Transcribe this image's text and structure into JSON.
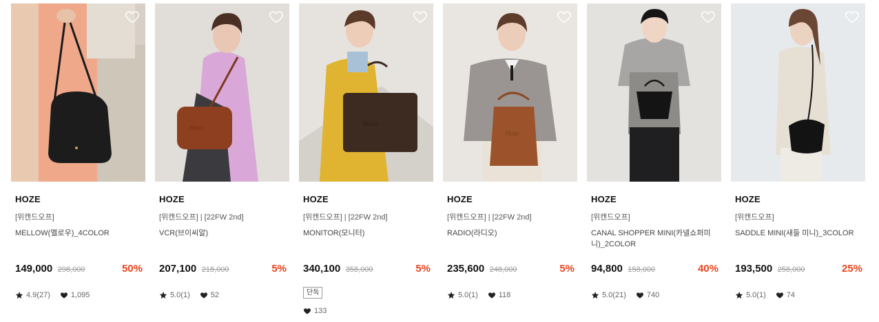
{
  "colors": {
    "discount": "#e8441e",
    "price": "#111111",
    "strike": "#999999"
  },
  "products": [
    {
      "brand": "HOZE",
      "tag": "[위캔드오프]",
      "name": "MELLOW(멜로우)_4COLOR",
      "price": "149,000",
      "original_price": "298,000",
      "discount": "50%",
      "rating": "4.9(27)",
      "likes": "1,095",
      "image": "woman holding black hobo bag"
    },
    {
      "brand": "HOZE",
      "tag": "[위캔드오프] | [22FW 2nd]",
      "name": "VCR(브이씨알)",
      "price": "207,100",
      "original_price": "218,000",
      "discount": "5%",
      "rating": "5.0(1)",
      "likes": "52",
      "image": "woman in pink sweater with brown crossbody bag"
    },
    {
      "brand": "HOZE",
      "tag": "[위캔드오프] | [22FW 2nd]",
      "name": "MONITOR(모니터)",
      "price": "340,100",
      "original_price": "358,000",
      "discount": "5%",
      "badge": "단독",
      "likes": "133",
      "image": "woman in yellow jacket with dark brown briefcase bag"
    },
    {
      "brand": "HOZE",
      "tag": "[위캔드오프] | [22FW 2nd]",
      "name": "RADIO(라디오)",
      "price": "235,600",
      "original_price": "248,000",
      "discount": "5%",
      "rating": "5.0(1)",
      "likes": "118",
      "image": "woman in grey cardigan with brown tote"
    },
    {
      "brand": "HOZE",
      "tag": "[위캔드오프]",
      "name": "CANAL SHOPPER MINI(카넬쇼퍼미니)_2COLOR",
      "price": "94,800",
      "original_price": "158,000",
      "discount": "40%",
      "rating": "5.0(21)",
      "likes": "740",
      "image": "woman in grey knit vest with black mini shopper"
    },
    {
      "brand": "HOZE",
      "tag": "[위캔드오프]",
      "name": "SADDLE MINI(새들 미니)_3COLOR",
      "price": "193,500",
      "original_price": "258,000",
      "discount": "25%",
      "rating": "5.0(1)",
      "likes": "74",
      "image": "woman in white dress with black saddle bag"
    }
  ]
}
